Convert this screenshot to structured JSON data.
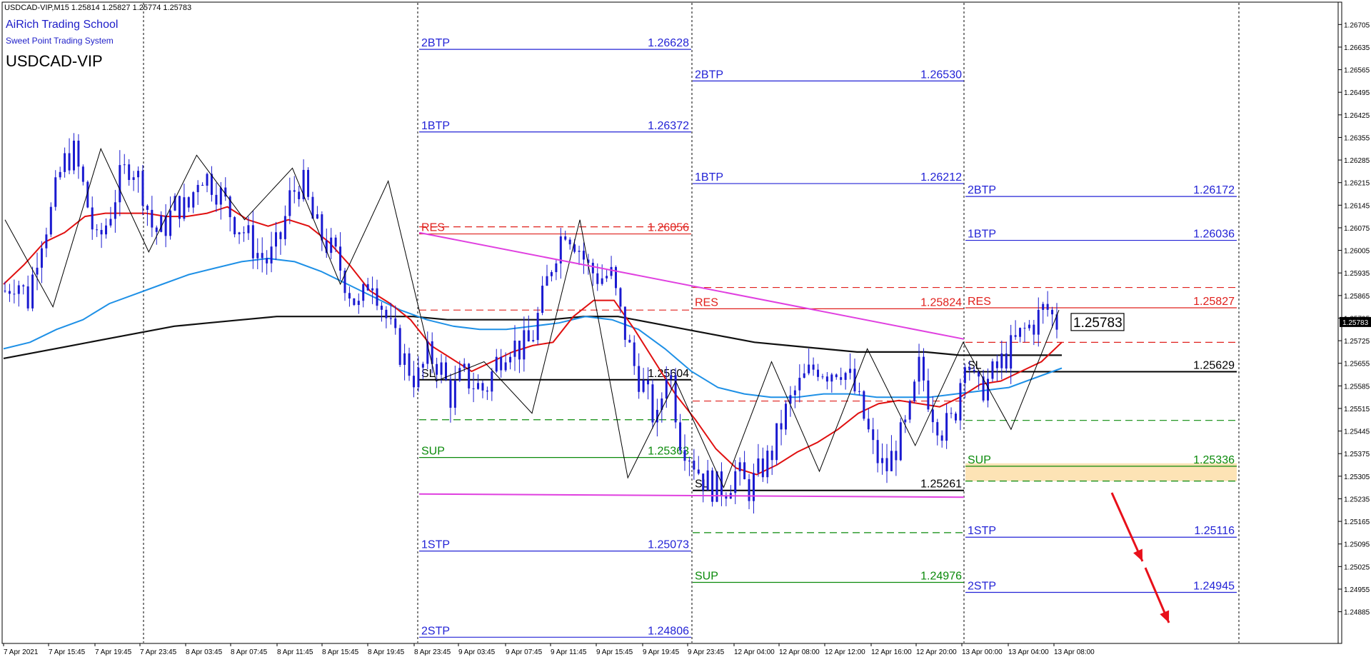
{
  "window": {
    "header": "USDCAD-VIP,M15  1.25814 1.25827 1.25774 1.25783",
    "brand": "AiRich Trading School",
    "subtitle": "Sweet Point Trading System",
    "symbol": "USDCAD-VIP"
  },
  "colors": {
    "blue_level": "#2323d6",
    "red_level": "#e0201c",
    "green_level": "#0a8a0a",
    "magenta": "#e040e0",
    "ma_red": "#e01010",
    "ma_blue": "#1e90e6",
    "ma_black": "#101010",
    "sup_zone": "#fde3b5",
    "arrow": "#e8101a"
  },
  "chart_data": {
    "type": "candlestick",
    "ylim": [
      1.248,
      1.2675
    ],
    "price_ticks": [
      "1.26705",
      "1.26635",
      "1.26565",
      "1.26495",
      "1.26425",
      "1.26355",
      "1.26285",
      "1.26215",
      "1.26145",
      "1.26075",
      "1.26005",
      "1.25935",
      "1.25865",
      "1.25795",
      "1.25725",
      "1.25655",
      "1.25585",
      "1.25515",
      "1.25445",
      "1.25375",
      "1.25305",
      "1.25235",
      "1.25165",
      "1.25095",
      "1.25025",
      "1.24955",
      "1.24885"
    ],
    "current_price": "1.25783",
    "time_ticks": [
      "7 Apr 2021",
      "7 Apr 15:45",
      "7 Apr 19:45",
      "7 Apr 23:45",
      "8 Apr 03:45",
      "8 Apr 07:45",
      "8 Apr 11:45",
      "8 Apr 15:45",
      "8 Apr 19:45",
      "8 Apr 23:45",
      "9 Apr 03:45",
      "9 Apr 07:45",
      "9 Apr 11:45",
      "9 Apr 15:45",
      "9 Apr 19:45",
      "9 Apr 23:45",
      "12 Apr 04:00",
      "12 Apr 08:00",
      "12 Apr 12:00",
      "12 Apr 16:00",
      "12 Apr 20:00",
      "13 Apr 00:00",
      "13 Apr 04:00",
      "13 Apr 08:00"
    ],
    "session_separators": [
      "7 Apr 23:45",
      "8 Apr 23:45",
      "9 Apr 23:45",
      "13 Apr 00:00"
    ],
    "blocks": [
      {
        "levels": [
          {
            "label": "2BTP",
            "value": "1.26628",
            "color": "blue"
          },
          {
            "label": "1BTP",
            "value": "1.26372",
            "color": "blue"
          },
          {
            "label": "RES",
            "value": "1.26056",
            "color": "red"
          },
          {
            "label": "SL",
            "value": "1.25604",
            "color": "black"
          },
          {
            "label": "SUP",
            "value": "1.25363",
            "color": "green"
          },
          {
            "label": "1STP",
            "value": "1.25073",
            "color": "blue"
          },
          {
            "label": "2STP",
            "value": "1.24806",
            "color": "blue"
          }
        ],
        "dashed": [
          {
            "value": 1.26078,
            "color": "red"
          },
          {
            "value": 1.2582,
            "color": "red"
          },
          {
            "value": 1.2548,
            "color": "green"
          }
        ]
      },
      {
        "levels": [
          {
            "label": "2BTP",
            "value": "1.26530",
            "color": "blue"
          },
          {
            "label": "1BTP",
            "value": "1.26212",
            "color": "blue"
          },
          {
            "label": "RES",
            "value": "1.25824",
            "color": "red"
          },
          {
            "label": "SL",
            "value": "1.25261",
            "color": "black"
          },
          {
            "label": "SUP",
            "value": "1.24976",
            "color": "green"
          }
        ],
        "dashed": [
          {
            "value": 1.2589,
            "color": "red"
          },
          {
            "value": 1.25538,
            "color": "red"
          },
          {
            "value": 1.2513,
            "color": "green"
          }
        ]
      },
      {
        "levels": [
          {
            "label": "2BTP",
            "value": "1.26172",
            "color": "blue"
          },
          {
            "label": "1BTP",
            "value": "1.26036",
            "color": "blue"
          },
          {
            "label": "RES",
            "value": "1.25827",
            "color": "red"
          },
          {
            "label": "SL",
            "value": "1.25629",
            "color": "black"
          },
          {
            "label": "SUP",
            "value": "1.25336",
            "color": "green"
          },
          {
            "label": "1STP",
            "value": "1.25116",
            "color": "blue"
          },
          {
            "label": "2STP",
            "value": "1.24945",
            "color": "blue"
          }
        ],
        "dashed": [
          {
            "value": 1.2589,
            "color": "red"
          },
          {
            "value": 1.2572,
            "color": "red"
          },
          {
            "value": 1.25478,
            "color": "green"
          },
          {
            "value": 1.2529,
            "color": "green"
          }
        ],
        "sup_zone": [
          1.2529,
          1.25345
        ]
      }
    ],
    "magenta_trendline": [
      [
        1.2606,
        1.2573
      ]
    ],
    "magenta_flat": [
      1.2525,
      1.2524
    ],
    "zigzag": [
      1.261,
      1.2583,
      1.2632,
      1.26,
      1.263,
      1.261,
      1.2626,
      1.259,
      1.2622,
      1.256,
      1.2566,
      1.255,
      1.261,
      1.253,
      1.256,
      1.2527,
      1.2566,
      1.2532,
      1.257,
      1.254,
      1.2572,
      1.2545,
      1.2582
    ],
    "close_series": [
      1.2588,
      1.2592,
      1.2585,
      1.2603,
      1.2612,
      1.2627,
      1.2631,
      1.2618,
      1.2602,
      1.261,
      1.2622,
      1.2628,
      1.262,
      1.2606,
      1.2608,
      1.2615,
      1.2613,
      1.2625,
      1.2622,
      1.2617,
      1.261,
      1.2606,
      1.26,
      1.2597,
      1.2603,
      1.2618,
      1.2622,
      1.2609,
      1.2603,
      1.2598,
      1.2589,
      1.2582,
      1.2594,
      1.2583,
      1.2573,
      1.2566,
      1.256,
      1.2568,
      1.2565,
      1.2555,
      1.2562,
      1.2559,
      1.2557,
      1.2566,
      1.2572,
      1.257,
      1.2572,
      1.2585,
      1.2599,
      1.2608,
      1.2603,
      1.2595,
      1.2592,
      1.2593,
      1.2578,
      1.2565,
      1.2557,
      1.2546,
      1.2567,
      1.2543,
      1.2537,
      1.253,
      1.2527,
      1.2527,
      1.2532,
      1.2526,
      1.2532,
      1.2537,
      1.2548,
      1.2556,
      1.2561,
      1.2565,
      1.2563,
      1.2565,
      1.256,
      1.255,
      1.2538,
      1.2532,
      1.254,
      1.2547,
      1.2565,
      1.2552,
      1.2545,
      1.2548,
      1.257,
      1.2556,
      1.256,
      1.2565,
      1.257,
      1.2575,
      1.2578,
      1.2583,
      1.2578
    ],
    "ma_red": [
      1.259,
      1.2596,
      1.2603,
      1.2606,
      1.2611,
      1.2612,
      1.2612,
      1.2612,
      1.2611,
      1.2611,
      1.2612,
      1.2614,
      1.261,
      1.2608,
      1.261,
      1.2608,
      1.2603,
      1.2596,
      1.2588,
      1.2584,
      1.2579,
      1.2571,
      1.2567,
      1.2563,
      1.2566,
      1.2569,
      1.2571,
      1.2572,
      1.258,
      1.2585,
      1.2585,
      1.2576,
      1.2566,
      1.2556,
      1.2548,
      1.2539,
      1.2533,
      1.2531,
      1.2534,
      1.2538,
      1.2541,
      1.2545,
      1.255,
      1.2553,
      1.2554,
      1.2553,
      1.2552,
      1.2555,
      1.2559,
      1.256,
      1.2563,
      1.2566,
      1.2572
    ],
    "ma_blue": [
      1.257,
      1.2572,
      1.2576,
      1.2579,
      1.2584,
      1.2587,
      1.259,
      1.2593,
      1.2595,
      1.2597,
      1.2598,
      1.2597,
      1.2594,
      1.259,
      1.2586,
      1.2582,
      1.2579,
      1.2577,
      1.2576,
      1.2576,
      1.2577,
      1.2578,
      1.258,
      1.2579,
      1.2576,
      1.257,
      1.2563,
      1.2558,
      1.2556,
      1.2555,
      1.2555,
      1.2556,
      1.2556,
      1.2555,
      1.2555,
      1.2555,
      1.2556,
      1.2557,
      1.2558,
      1.2561,
      1.2564
    ],
    "ma_black": [
      1.2567,
      1.2569,
      1.2571,
      1.2573,
      1.2575,
      1.2577,
      1.2578,
      1.2579,
      1.258,
      1.258,
      1.258,
      1.258,
      1.258,
      1.2579,
      1.2579,
      1.2579,
      1.2579,
      1.258,
      1.258,
      1.2578,
      1.2576,
      1.2574,
      1.2572,
      1.2571,
      1.257,
      1.2569,
      1.2569,
      1.2569,
      1.2568,
      1.2568,
      1.2568,
      1.2568
    ]
  }
}
